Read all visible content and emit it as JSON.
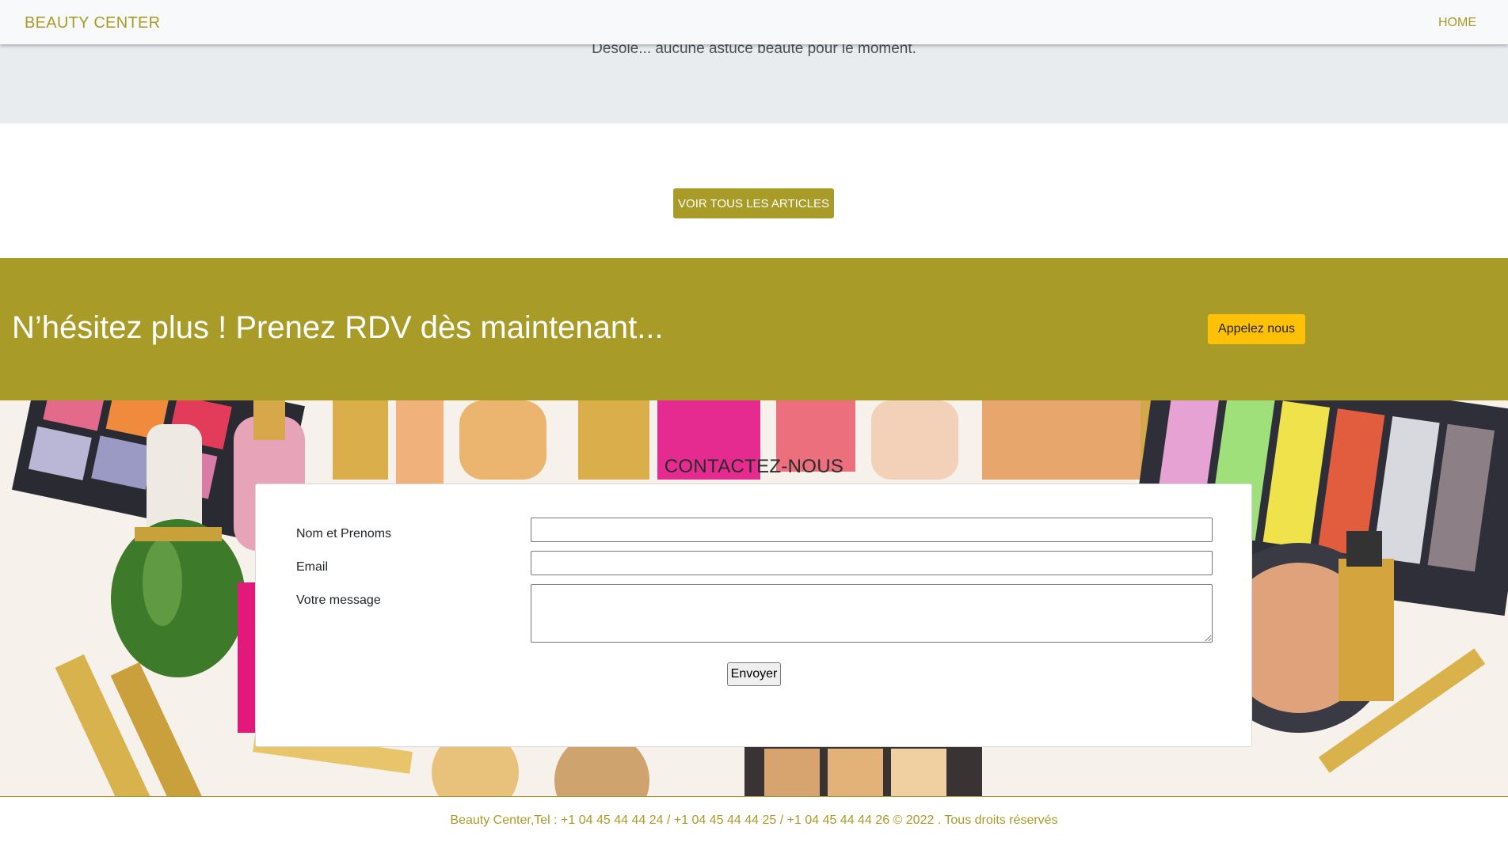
{
  "navbar": {
    "brand": "BEAUTY CENTER",
    "home_link": "HOME"
  },
  "tips": {
    "empty_message": "Désolé... aucune astuce beauté pour le moment."
  },
  "articles": {
    "view_all_label": "VOIR TOUS LES ARTICLES"
  },
  "cta": {
    "title": "N’hésitez plus ! Prenez RDV dès maintenant...",
    "call_label": "Appelez nous"
  },
  "contact": {
    "title": "CONTACTEZ-NOUS",
    "fields": {
      "name_label": "Nom et Prenoms",
      "name_value": "",
      "email_label": "Email",
      "email_value": "",
      "message_label": "Votre message",
      "message_value": ""
    },
    "submit_label": "Envoyer"
  },
  "footer": {
    "text": "Beauty Center,Tel : +1 04 45 44 44 24 / +1 04 45 44 44 25 / +1 04 45 44 44 26 © 2022 . Tous droits réservés"
  },
  "colors": {
    "brand_olive": "#a99b28",
    "cta_yellow": "#ffc107",
    "tips_band": "#e9ecef",
    "navbar_bg": "#f8f9fa"
  },
  "icons": {
    "textarea_resize": "resize-handle-icon"
  }
}
